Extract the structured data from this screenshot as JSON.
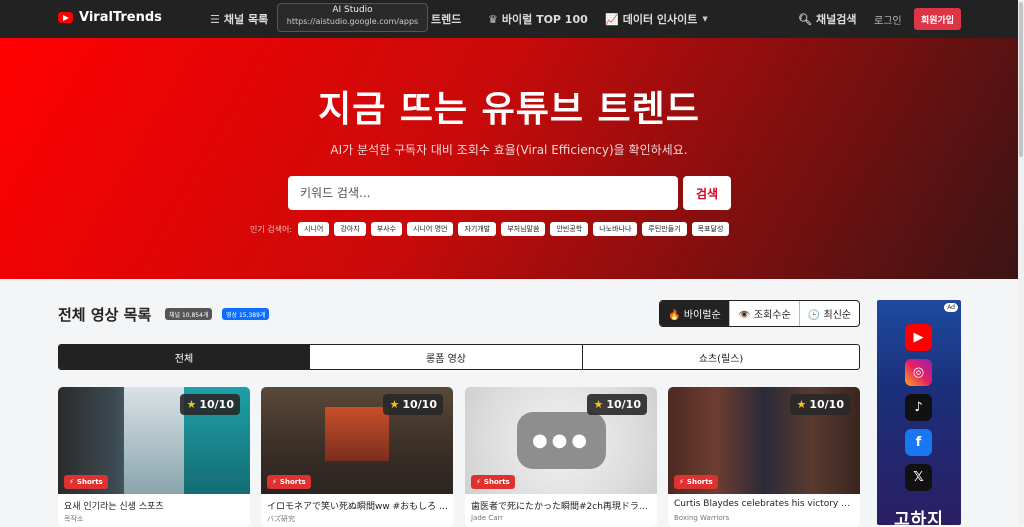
{
  "nav": {
    "brand": "ViralTrends",
    "items": [
      "채널 목록",
      "트렌드",
      "바이럴 TOP 100",
      "데이터 인사이트"
    ],
    "search_label": "채널검색",
    "login": "로그인",
    "signup": "회원가입"
  },
  "tooltip": {
    "title": "AI Studio",
    "url": "https://aistudio.google.com/apps"
  },
  "hero": {
    "title": "지금 뜨는 유튜브 트렌드",
    "subtitle": "AI가 분석한 구독자 대비 조회수 효율(Viral Efficiency)을 확인하세요.",
    "search_placeholder": "키워드 검색...",
    "search_button": "검색",
    "popular_label": "인기 검색어:",
    "popular_tags": [
      "시니어",
      "강아지",
      "부사수",
      "시니어 명언",
      "자기개발",
      "부처님말씀",
      "안빈공학",
      "나노바나나",
      "루틴만들기",
      "목표달성"
    ]
  },
  "list": {
    "title": "전체 영상 목록",
    "badge_channels": "채널 10,854개",
    "badge_videos": "영상 15,389개",
    "sort": [
      "🔥 바이럴순",
      "👁️ 조회수순",
      "🕒 최신순"
    ],
    "tabs": [
      "전체",
      "롱폼 영상",
      "쇼츠(릴스)"
    ]
  },
  "cards": [
    {
      "score": "10/10",
      "badge": "Shorts",
      "title": "요새 인기라는 신생 스포츠",
      "channel": "목작소"
    },
    {
      "score": "10/10",
      "badge": "Shorts",
      "title": "イロモネアで笑い死ぬ瞬間ww #おもしろ #…",
      "channel": "バズ研究"
    },
    {
      "score": "10/10",
      "badge": "Shorts",
      "title": "歯医者で死にたかった瞬間#2ch再現ドラマ…",
      "channel": "Jade Carr"
    },
    {
      "score": "10/10",
      "badge": "Shorts",
      "title": "Curtis Blaydes celebrates his victory with…",
      "channel": "Boxing Warriors"
    }
  ],
  "ad": {
    "tag": "Ad",
    "text": "고하지"
  },
  "colors": {
    "nav": "#222222",
    "accent": "#dc3545",
    "hero_start": "#ff0000",
    "hero_end": "#3a1414"
  }
}
